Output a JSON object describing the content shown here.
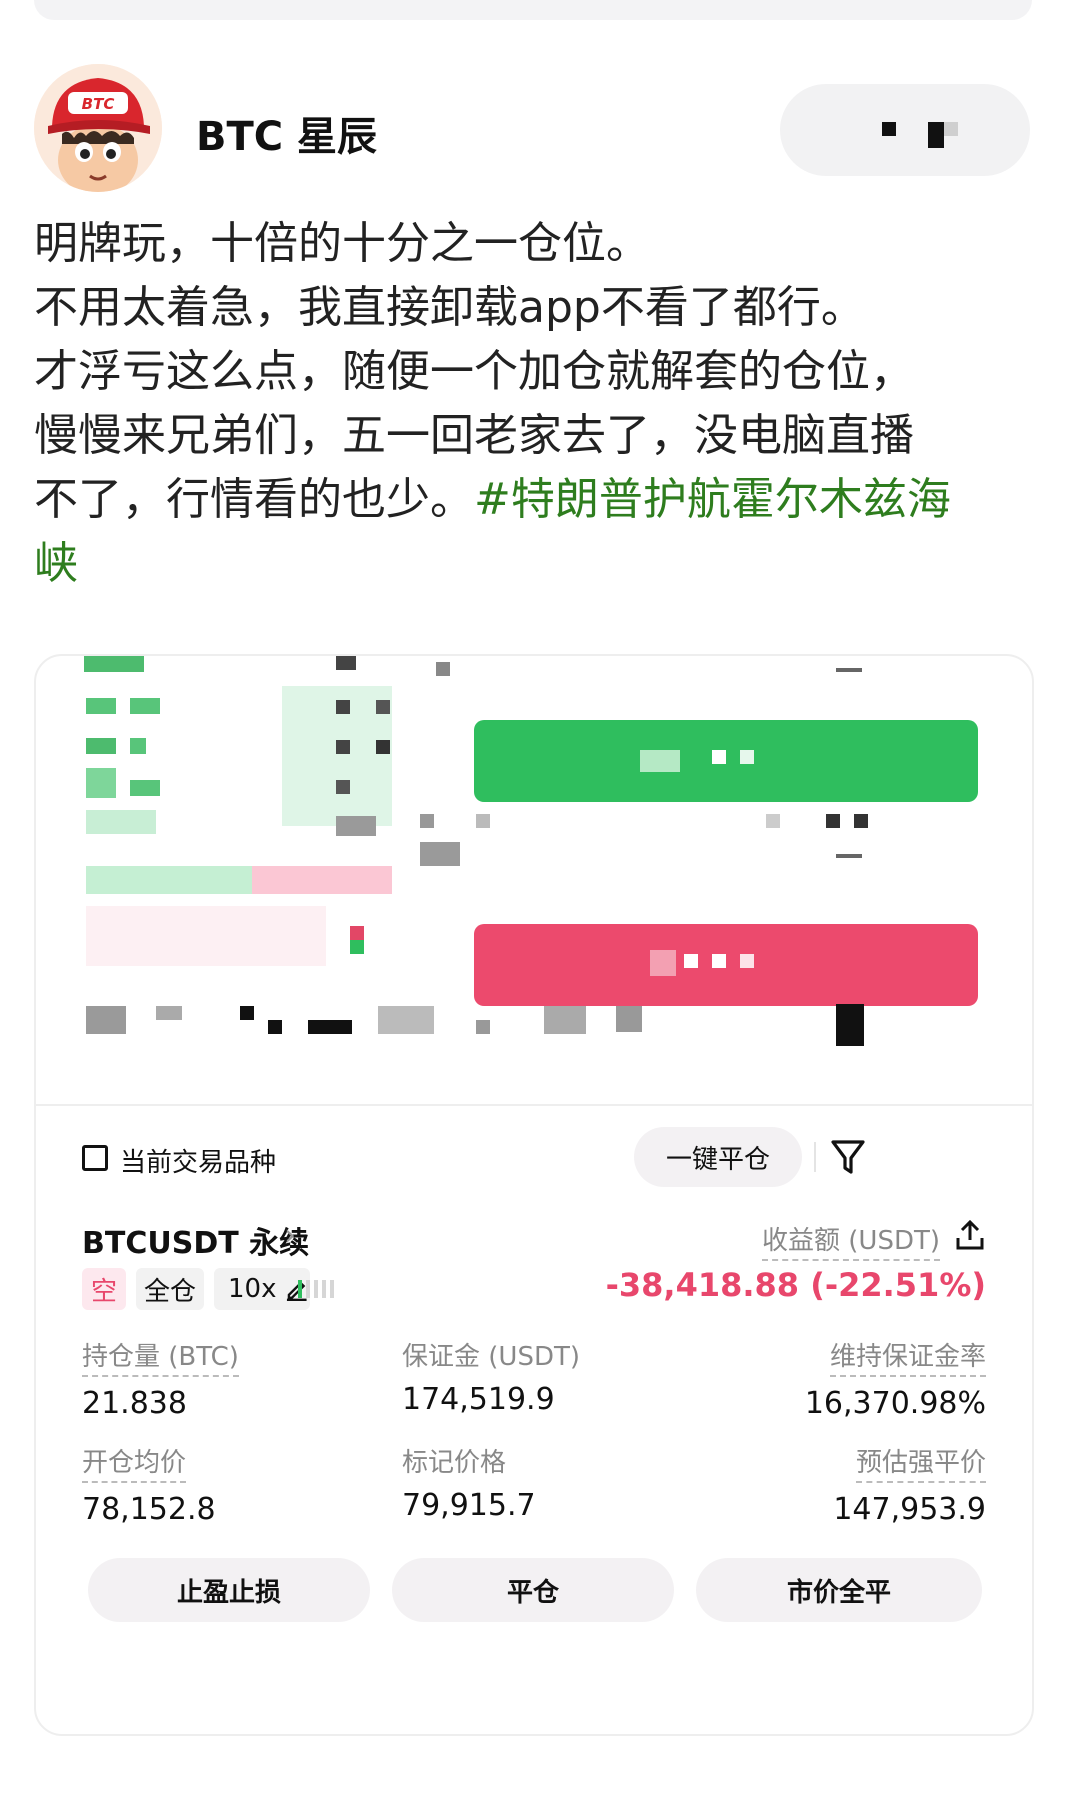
{
  "author": {
    "name": "BTC 星辰",
    "avatar_cap_text": "BTC"
  },
  "post": {
    "lines": [
      "明牌玩，十倍的十分之一仓位。",
      "不用太着急，我直接卸载app不看了都行。",
      "才浮亏这么点，随便一个加仓就解套的仓位，",
      "慢慢来兄弟们，五一回老家去了，没电脑直播",
      "不了，行情看的也少。"
    ],
    "hashtag_part1": "#特朗普护航霍尔木兹海",
    "hashtag_part2": "峡"
  },
  "position_panel": {
    "current_symbol_label": "当前交易品种",
    "close_all_label": "一键平仓",
    "filter_icon": "filter-icon",
    "symbol": "BTCUSDT 永续",
    "symbol_chevron": "›",
    "tags": {
      "side": "空",
      "margin_mode": "全仓",
      "leverage": "10x"
    },
    "pnl_label": "收益额 (USDT)",
    "pnl_value": "-38,418.88 (-22.51%)",
    "stats": {
      "size_label": "持仓量 (BTC)",
      "size_value": "21.838",
      "margin_label": "保证金 (USDT)",
      "margin_value": "174,519.9",
      "maint_label": "维持保证金率",
      "maint_value": "16,370.98%",
      "entry_label": "开仓均价",
      "entry_value": "78,152.8",
      "mark_label": "标记价格",
      "mark_value": "79,915.7",
      "liq_label": "预估强平价",
      "liq_value": "147,953.9"
    },
    "buttons": {
      "tp_sl": "止盈止损",
      "close": "平仓",
      "market_close_all": "市价全平"
    },
    "colors": {
      "long_green": "#2fbe5e",
      "short_red": "#ec4a6d",
      "pnl_red": "#e8476c",
      "hashtag_green": "#2e7d1e"
    }
  }
}
